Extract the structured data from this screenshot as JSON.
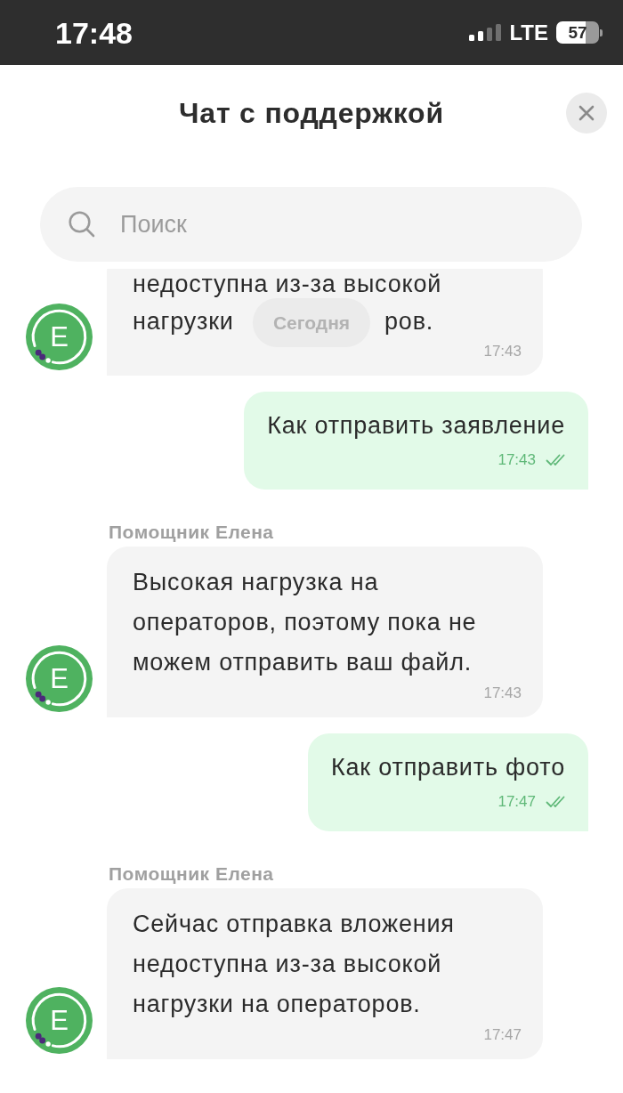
{
  "status_bar": {
    "time": "17:48",
    "network": "LTE",
    "battery": "57"
  },
  "header": {
    "title": "Чат с поддержкой"
  },
  "search": {
    "placeholder": "Поиск"
  },
  "date_chip": {
    "label": "Сегодня"
  },
  "messages": [
    {
      "kind": "incoming",
      "avatar": "Е",
      "lines": [
        [
          "недоступна из-за высокой"
        ],
        [
          "нагрузки",
          "ров."
        ]
      ],
      "time": "17:43"
    },
    {
      "kind": "outgoing",
      "text": "Как отправить заявление",
      "time": "17:43",
      "read": true
    },
    {
      "kind": "incoming",
      "avatar": "Е",
      "sender": "Помощник Елена",
      "text": "Высокая нагрузка на операторов, поэтому пока не можем отправить ваш файл.",
      "time": "17:43"
    },
    {
      "kind": "outgoing",
      "text": "Как отправить фото",
      "time": "17:47",
      "read": true
    },
    {
      "kind": "incoming",
      "avatar": "Е",
      "sender": "Помощник Елена",
      "text": "Сейчас отправка вложения недоступна из-за высокой нагрузки на операторов.",
      "time": "17:47"
    }
  ]
}
